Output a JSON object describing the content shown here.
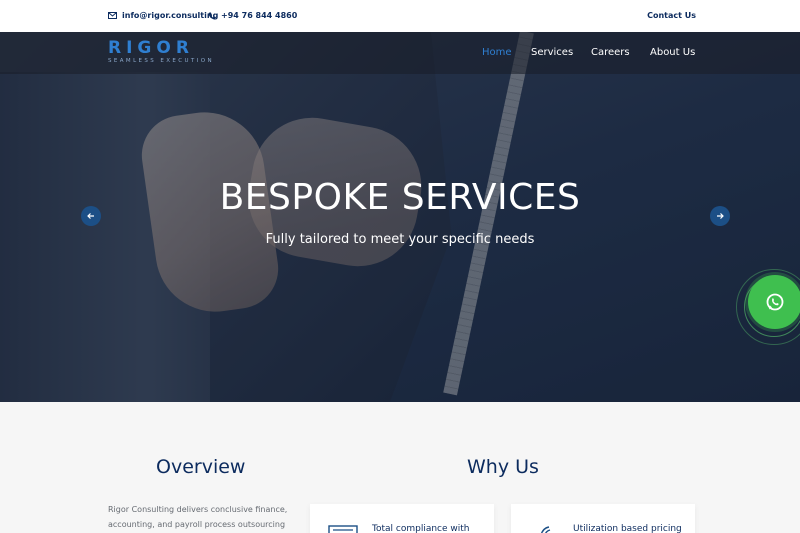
{
  "topbar": {
    "email": "info@rigor.consulting",
    "phone": "+94 76 844 4860",
    "contact_link": "Contact Us"
  },
  "brand": {
    "logo_text": "RIGOR",
    "tagline": "SEAMLESS EXECUTION",
    "accent_color": "#2f7fd1",
    "navy_color": "#0c2b5e"
  },
  "nav": {
    "items": [
      {
        "label": "Home",
        "active": true
      },
      {
        "label": "Services",
        "active": false
      },
      {
        "label": "Careers",
        "active": false
      },
      {
        "label": "About Us",
        "active": false
      }
    ]
  },
  "hero": {
    "title": "BESPOKE SERVICES",
    "subtitle": "Fully tailored to meet your specific needs",
    "prev_icon": "arrow-left-icon",
    "next_icon": "arrow-right-icon"
  },
  "whatsapp": {
    "icon": "whatsapp-icon",
    "color": "#3fbf4f"
  },
  "overview": {
    "heading": "Overview",
    "text": "Rigor Consulting delivers conclusive finance, accounting, and payroll process outsourcing"
  },
  "why_us": {
    "heading": "Why Us",
    "cards": [
      {
        "label": "Total compliance with",
        "icon": "compliance-icon"
      },
      {
        "label": "Utilization based pricing",
        "icon": "pricing-icon"
      }
    ]
  }
}
